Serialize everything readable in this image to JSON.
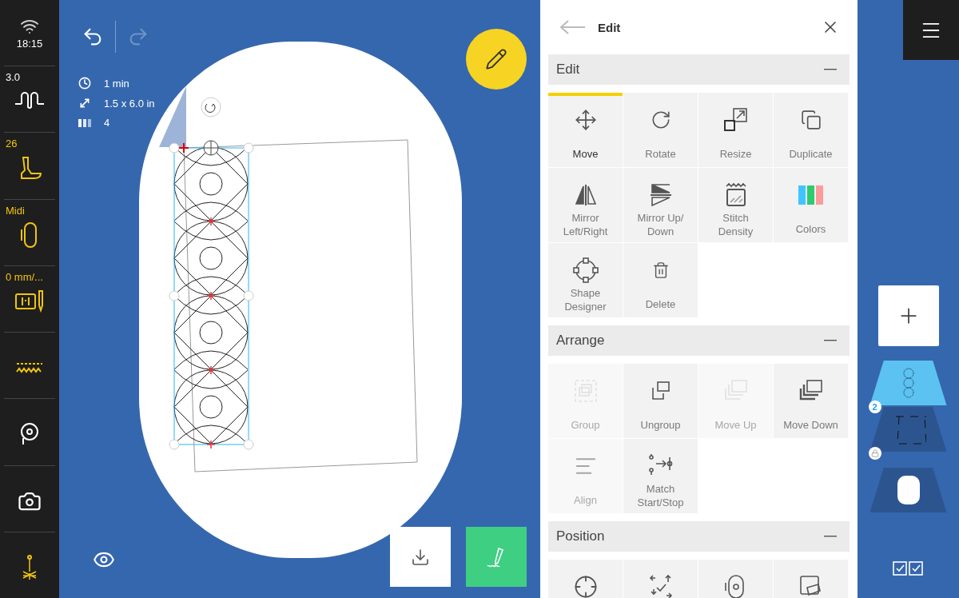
{
  "status": {
    "time": "18:15"
  },
  "sidebar": {
    "items": [
      {
        "kind": "stitch",
        "label": "3.0",
        "highlighted": false
      },
      {
        "kind": "foot",
        "label": "26",
        "highlighted": true
      },
      {
        "kind": "hoop",
        "label": "Midi",
        "highlighted": true
      },
      {
        "kind": "needle",
        "label": "0 mm/...",
        "highlighted": true
      },
      {
        "kind": "zigzag",
        "highlighted": true
      },
      {
        "kind": "bobbin",
        "highlighted": false
      },
      {
        "kind": "camera",
        "highlighted": false
      },
      {
        "kind": "light",
        "highlighted": true
      }
    ]
  },
  "canvas": {
    "undo": {
      "disabled": false
    },
    "redo": {
      "disabled": true
    },
    "info": [
      {
        "kind": "time",
        "text": "1 min"
      },
      {
        "kind": "size",
        "text": "1.5 x 6.0 in"
      },
      {
        "kind": "colors",
        "text": "4"
      }
    ]
  },
  "panel": {
    "title": "Edit",
    "sections": [
      {
        "title": "Edit",
        "expanded": true,
        "tiles": [
          {
            "label": "Move",
            "selected": true,
            "disabled": false
          },
          {
            "label": "Rotate",
            "selected": false,
            "disabled": false
          },
          {
            "label": "Resize",
            "selected": false,
            "disabled": false
          },
          {
            "label": "Duplicate",
            "selected": false,
            "disabled": false
          },
          {
            "label": "Mirror Left/Right",
            "selected": false,
            "disabled": false
          },
          {
            "label": "Mirror Up/ Down",
            "selected": false,
            "disabled": false
          },
          {
            "label": "Stitch Density",
            "selected": false,
            "disabled": false
          },
          {
            "label": "Colors",
            "selected": false,
            "disabled": false
          },
          {
            "label": "Shape Designer",
            "selected": false,
            "disabled": false
          },
          {
            "label": "Delete",
            "selected": false,
            "disabled": false
          }
        ]
      },
      {
        "title": "Arrange",
        "expanded": true,
        "tiles": [
          {
            "label": "Group",
            "selected": false,
            "disabled": true
          },
          {
            "label": "Ungroup",
            "selected": false,
            "disabled": false
          },
          {
            "label": "Move Up",
            "selected": false,
            "disabled": true
          },
          {
            "label": "Move Down",
            "selected": false,
            "disabled": false
          },
          {
            "label": "Align",
            "selected": false,
            "disabled": true
          },
          {
            "label": "Match Start/Stop",
            "selected": false,
            "disabled": false
          }
        ]
      },
      {
        "title": "Position",
        "expanded": true,
        "tiles": [
          {
            "selected": false,
            "disabled": false
          },
          {
            "selected": false,
            "disabled": false
          },
          {
            "selected": false,
            "disabled": false
          },
          {
            "selected": false,
            "disabled": false
          }
        ]
      }
    ]
  },
  "layers": [
    {
      "kind": "design",
      "selected": true,
      "badge": "2"
    },
    {
      "kind": "outline",
      "selected": false,
      "locked": true
    },
    {
      "kind": "hoop",
      "selected": false
    }
  ]
}
